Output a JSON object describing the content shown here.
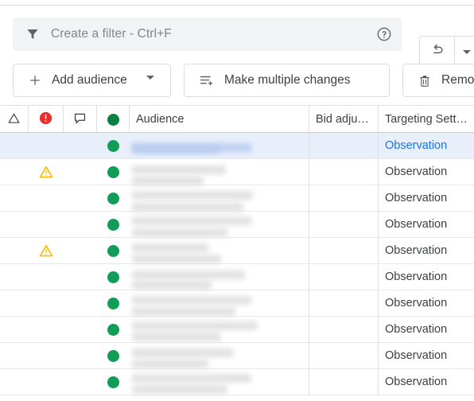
{
  "colors": {
    "accent_blue": "#1a73e8",
    "status_green": "#0f9d58",
    "error_red": "#e8302f",
    "warning_yellow": "#fbbc04",
    "row_selected": "#e8eefa",
    "field_bg": "#f1f3f4",
    "border": "#dadce0",
    "text": "#3c4043",
    "placeholder": "#80868b"
  },
  "filter_bar": {
    "placeholder": "Create a filter - Ctrl+F",
    "value": "",
    "funnel_icon": "funnel-icon",
    "help_icon": "help-circle-icon"
  },
  "undo": {
    "icon": "undo-arrow-icon",
    "dropdown_icon": "chevron-down-icon"
  },
  "toolbar": {
    "add_audience_label": "Add audience",
    "add_audience_icon": "plus-icon",
    "add_audience_caret_icon": "chevron-down-icon",
    "make_multiple_changes_label": "Make multiple changes",
    "make_multiple_changes_icon": "list-plus-icon",
    "remove_label": "Remove",
    "remove_icon": "trash-icon"
  },
  "table": {
    "headers": {
      "triangle": "",
      "triangle_icon": "triangle-outline-icon",
      "error": "",
      "error_icon": "error-circle-icon",
      "note": "",
      "note_icon": "comment-bubble-icon",
      "status": "",
      "status_icon": "green-dot-icon",
      "audience": "Audience",
      "bid_adjustment": "Bid adju…",
      "targeting_setting": "Targeting Sett…"
    },
    "rows": [
      {
        "triangle": "",
        "warning": false,
        "note": "",
        "status": "green-dot-icon",
        "audience": "",
        "bid_adjustment": "",
        "targeting_setting": "Observation",
        "selected": true
      },
      {
        "triangle": "",
        "warning": true,
        "note": "",
        "status": "green-dot-icon",
        "audience": "",
        "bid_adjustment": "",
        "targeting_setting": "Observation",
        "selected": false
      },
      {
        "triangle": "",
        "warning": false,
        "note": "",
        "status": "green-dot-icon",
        "audience": "",
        "bid_adjustment": "",
        "targeting_setting": "Observation",
        "selected": false
      },
      {
        "triangle": "",
        "warning": false,
        "note": "",
        "status": "green-dot-icon",
        "audience": "",
        "bid_adjustment": "",
        "targeting_setting": "Observation",
        "selected": false
      },
      {
        "triangle": "",
        "warning": true,
        "note": "",
        "status": "green-dot-icon",
        "audience": "",
        "bid_adjustment": "",
        "targeting_setting": "Observation",
        "selected": false
      },
      {
        "triangle": "",
        "warning": false,
        "note": "",
        "status": "green-dot-icon",
        "audience": "",
        "bid_adjustment": "",
        "targeting_setting": "Observation",
        "selected": false
      },
      {
        "triangle": "",
        "warning": false,
        "note": "",
        "status": "green-dot-icon",
        "audience": "",
        "bid_adjustment": "",
        "targeting_setting": "Observation",
        "selected": false
      },
      {
        "triangle": "",
        "warning": false,
        "note": "",
        "status": "green-dot-icon",
        "audience": "",
        "bid_adjustment": "",
        "targeting_setting": "Observation",
        "selected": false
      },
      {
        "triangle": "",
        "warning": false,
        "note": "",
        "status": "green-dot-icon",
        "audience": "",
        "bid_adjustment": "",
        "targeting_setting": "Observation",
        "selected": false
      },
      {
        "triangle": "",
        "warning": false,
        "note": "",
        "status": "green-dot-icon",
        "audience": "",
        "bid_adjustment": "",
        "targeting_setting": "Observation",
        "selected": false
      }
    ]
  }
}
